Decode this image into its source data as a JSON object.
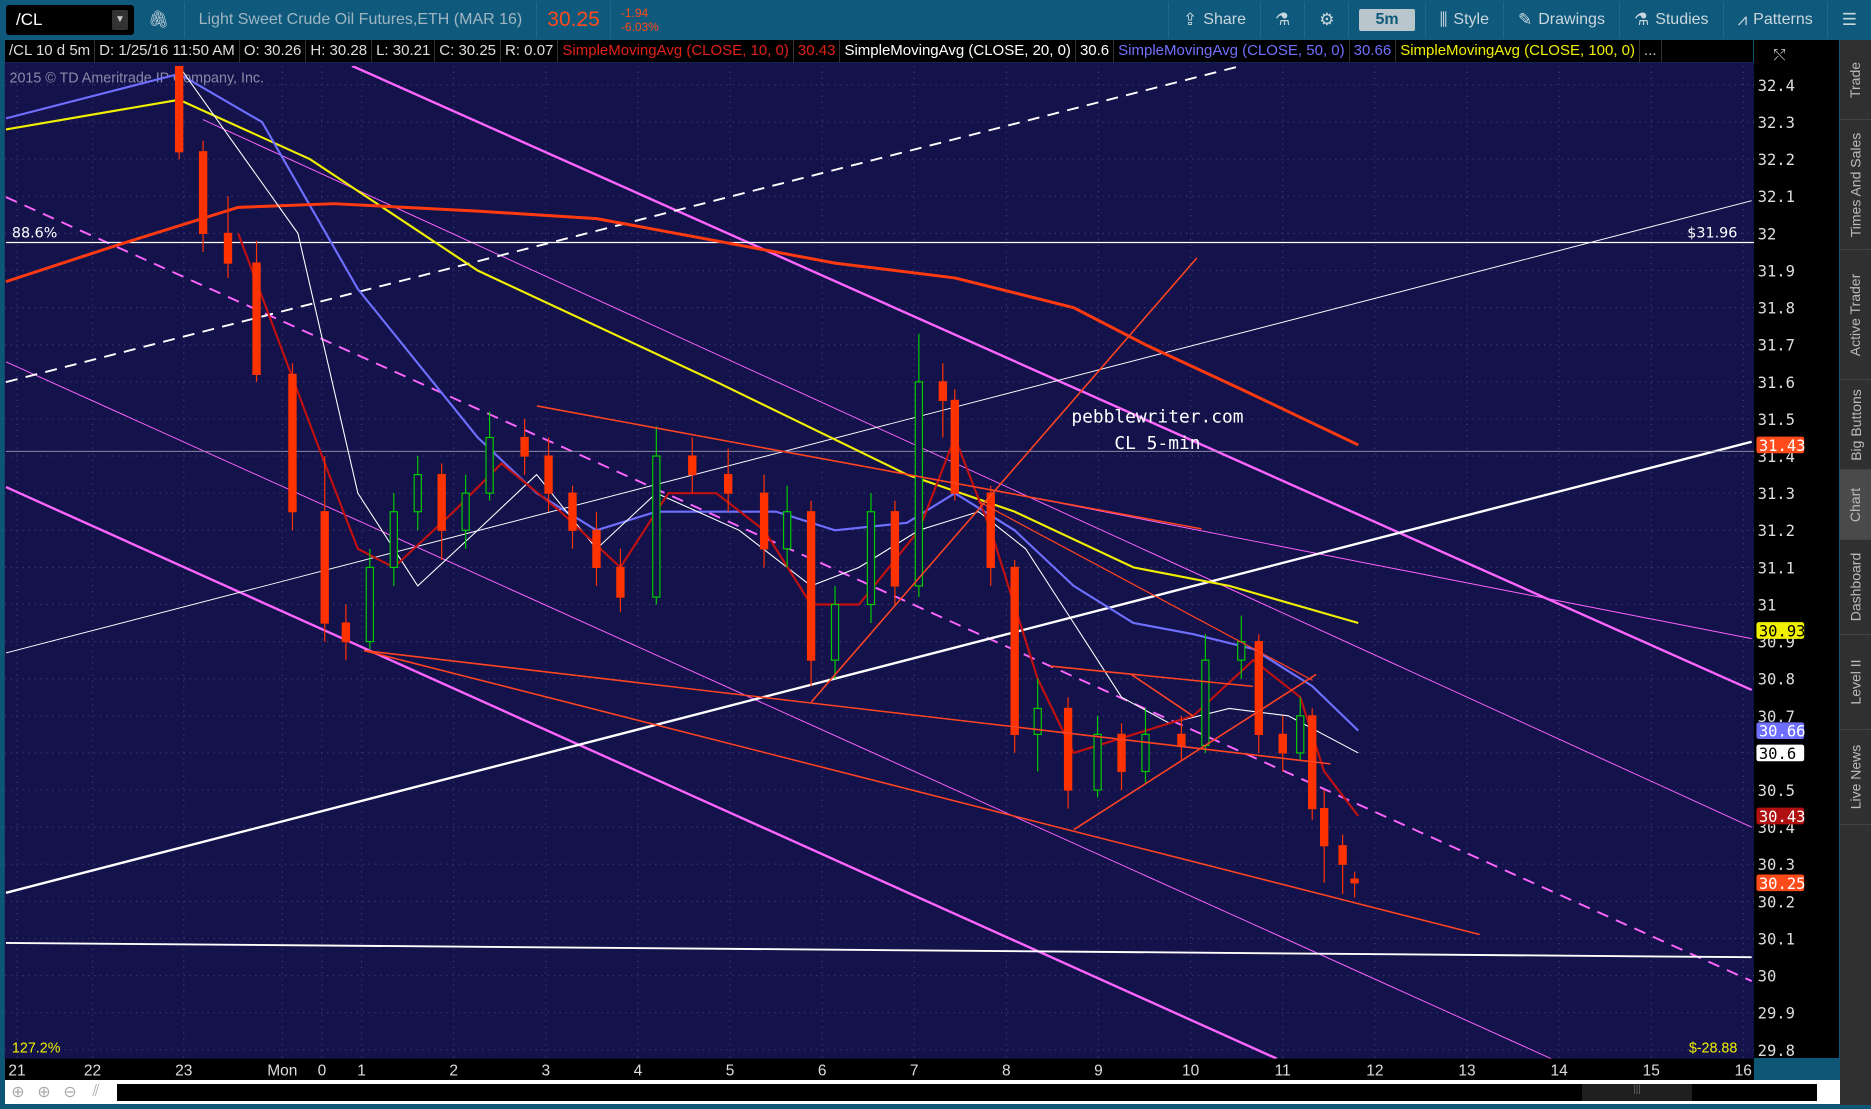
{
  "toolbar": {
    "symbol": "/CL",
    "description": "Light Sweet Crude Oil Futures,ETH (MAR 16)",
    "last": "30.25",
    "change": "-1.94",
    "change_pct": "-6.03%",
    "share": "Share",
    "timeframe": "5m",
    "style": "Style",
    "drawings": "Drawings",
    "studies": "Studies",
    "patterns": "Patterns"
  },
  "info": {
    "chart": "/CL 10 d 5m",
    "date": "D: 1/25/16 11:50 AM",
    "open": "O: 30.26",
    "high": "H: 30.28",
    "low": "L: 30.21",
    "close": "C: 30.25",
    "range": "R: 0.07",
    "studies": [
      {
        "name": "SimpleMovingAvg (CLOSE, 10, 0)",
        "value": "30.43",
        "color": "#e0201a"
      },
      {
        "name": "SimpleMovingAvg (CLOSE, 20, 0)",
        "value": "30.6",
        "color": "#ffffff"
      },
      {
        "name": "SimpleMovingAvg (CLOSE, 50, 0)",
        "value": "30.66",
        "color": "#7070ff"
      },
      {
        "name": "SimpleMovingAvg (CLOSE, 100, 0)",
        "value": "...",
        "color": "#f0f000"
      }
    ]
  },
  "watermark": "2015 © TD Ameritrade IP Company, Inc.",
  "annotation": {
    "line1": "pebblewriter.com",
    "line2": "CL 5-min"
  },
  "fib_labels": {
    "top_pct": "88.6%",
    "top_price": "$31.96",
    "bottom_pct": "127.2%",
    "bottom_price": "$-28.88"
  },
  "sidebar": [
    "Trade",
    "Times And Sales",
    "Active Trader",
    "Big Buttons",
    "Chart",
    "Dashboard",
    "Level II",
    "Live News"
  ],
  "colors": {
    "up": "#00cc00",
    "down": "#ff3300",
    "sma10": "#c01010",
    "sma20": "#ffffff",
    "sma50": "#6f6fff",
    "sma100": "#f0f000",
    "sma200": "#ff3a10",
    "background": "#14124a"
  },
  "chart_data": {
    "type": "candlestick",
    "ylim": [
      29.8,
      32.4
    ],
    "yticks": [
      "32.4",
      "32.3",
      "32.2",
      "32.1",
      "32",
      "31.9",
      "31.8",
      "31.7",
      "31.6",
      "31.5",
      "31.4",
      "31.3",
      "31.2",
      "31.1",
      "31",
      "30.9",
      "30.8",
      "30.7",
      "30.6",
      "30.5",
      "30.4",
      "30.3",
      "30.2",
      "30.1",
      "30",
      "29.9",
      "29.8"
    ],
    "xticks": [
      {
        "label": "21",
        "t": -2.74
      },
      {
        "label": "22",
        "t": -1.92
      },
      {
        "label": "23",
        "t": -0.93
      },
      {
        "label": "Mon",
        "t": 0.14
      },
      {
        "label": "0",
        "t": 0.57
      },
      {
        "label": "1",
        "t": 1
      },
      {
        "label": "2",
        "t": 2
      },
      {
        "label": "3",
        "t": 3
      },
      {
        "label": "4",
        "t": 4
      },
      {
        "label": "5",
        "t": 5
      },
      {
        "label": "6",
        "t": 6
      },
      {
        "label": "7",
        "t": 7
      },
      {
        "label": "8",
        "t": 8
      },
      {
        "label": "9",
        "t": 9
      },
      {
        "label": "10",
        "t": 10
      },
      {
        "label": "11",
        "t": 11
      },
      {
        "label": "12",
        "t": 12
      },
      {
        "label": "13",
        "t": 13
      },
      {
        "label": "14",
        "t": 14
      },
      {
        "label": "15",
        "t": 15
      },
      {
        "label": "16",
        "t": 16
      }
    ],
    "price_tags": [
      {
        "value": "31.43",
        "bg": "#ff4a1a",
        "fg": "#fff"
      },
      {
        "value": "30.93",
        "bg": "#f0f000",
        "fg": "#000"
      },
      {
        "value": "30.66",
        "bg": "#6f6fff",
        "fg": "#fff"
      },
      {
        "value": "30.6",
        "bg": "#ffffff",
        "fg": "#000"
      },
      {
        "value": "30.43",
        "bg": "#b01010",
        "fg": "#fff"
      },
      {
        "value": "30.25",
        "bg": "#ff4a1a",
        "fg": "#fff"
      }
    ],
    "candles": [
      [
        -0.98,
        32.45,
        32.47,
        32.2,
        32.22
      ],
      [
        -0.72,
        32.22,
        32.25,
        31.95,
        32.0
      ],
      [
        -0.45,
        32.0,
        32.1,
        31.88,
        31.92
      ],
      [
        -0.14,
        31.92,
        31.98,
        31.6,
        31.62
      ],
      [
        0.25,
        31.62,
        31.65,
        31.2,
        31.25
      ],
      [
        0.6,
        31.25,
        31.4,
        30.9,
        30.95
      ],
      [
        0.83,
        30.95,
        31.0,
        30.85,
        30.9
      ],
      [
        1.09,
        30.9,
        31.15,
        30.88,
        31.1
      ],
      [
        1.35,
        31.1,
        31.3,
        31.05,
        31.25
      ],
      [
        1.61,
        31.25,
        31.4,
        31.2,
        31.35
      ],
      [
        1.87,
        31.35,
        31.38,
        31.12,
        31.2
      ],
      [
        2.13,
        31.2,
        31.35,
        31.15,
        31.3
      ],
      [
        2.39,
        31.3,
        31.52,
        31.28,
        31.45
      ],
      [
        2.77,
        31.45,
        31.5,
        31.35,
        31.4
      ],
      [
        3.03,
        31.4,
        31.45,
        31.25,
        31.3
      ],
      [
        3.29,
        31.3,
        31.32,
        31.15,
        31.2
      ],
      [
        3.55,
        31.2,
        31.25,
        31.05,
        31.1
      ],
      [
        3.81,
        31.1,
        31.15,
        30.98,
        31.02
      ],
      [
        4.2,
        31.02,
        31.48,
        31.0,
        31.4
      ],
      [
        4.59,
        31.4,
        31.45,
        31.3,
        31.35
      ],
      [
        4.98,
        31.35,
        31.42,
        31.25,
        31.3
      ],
      [
        5.37,
        31.3,
        31.35,
        31.1,
        31.15
      ],
      [
        5.62,
        31.15,
        31.32,
        31.1,
        31.25
      ],
      [
        5.88,
        31.25,
        31.28,
        30.78,
        30.85
      ],
      [
        6.14,
        30.85,
        31.05,
        30.8,
        31.0
      ],
      [
        6.53,
        31.0,
        31.3,
        30.95,
        31.25
      ],
      [
        6.79,
        31.25,
        31.28,
        31.0,
        31.05
      ],
      [
        7.05,
        31.05,
        31.73,
        31.02,
        31.6
      ],
      [
        7.31,
        31.6,
        31.65,
        31.45,
        31.55
      ],
      [
        7.44,
        31.55,
        31.58,
        31.28,
        31.3
      ],
      [
        7.83,
        31.3,
        31.32,
        31.05,
        31.1
      ],
      [
        8.09,
        31.1,
        31.12,
        30.6,
        30.65
      ],
      [
        8.34,
        30.65,
        30.8,
        30.55,
        30.72
      ],
      [
        8.67,
        30.72,
        30.75,
        30.45,
        30.5
      ],
      [
        8.99,
        30.5,
        30.7,
        30.48,
        30.65
      ],
      [
        9.25,
        30.65,
        30.68,
        30.5,
        30.55
      ],
      [
        9.51,
        30.55,
        30.72,
        30.52,
        30.65
      ],
      [
        9.9,
        30.65,
        30.7,
        30.58,
        30.62
      ],
      [
        10.16,
        30.62,
        30.92,
        30.6,
        30.85
      ],
      [
        10.55,
        30.85,
        30.97,
        30.8,
        30.9
      ],
      [
        10.74,
        30.9,
        30.92,
        30.6,
        30.65
      ],
      [
        11.0,
        30.65,
        30.7,
        30.55,
        30.6
      ],
      [
        11.19,
        30.6,
        30.75,
        30.58,
        30.7
      ],
      [
        11.32,
        30.7,
        30.72,
        30.42,
        30.45
      ],
      [
        11.45,
        30.45,
        30.5,
        30.25,
        30.35
      ],
      [
        11.65,
        30.35,
        30.38,
        30.22,
        30.3
      ],
      [
        11.78,
        30.26,
        30.28,
        30.21,
        30.25
      ]
    ],
    "series": [
      {
        "name": "SMA100",
        "color": "#f0f000",
        "points": [
          [
            -2.86,
            32.28
          ],
          [
            -0.98,
            32.36
          ],
          [
            0.44,
            32.2
          ],
          [
            2.26,
            31.9
          ],
          [
            4.85,
            31.6
          ],
          [
            6.92,
            31.35
          ],
          [
            8.09,
            31.25
          ],
          [
            9.38,
            31.1
          ],
          [
            10.42,
            31.05
          ],
          [
            11.82,
            30.95
          ]
        ]
      },
      {
        "name": "SMA50",
        "color": "#6f6fff",
        "points": [
          [
            -2.86,
            32.31
          ],
          [
            -0.98,
            32.43
          ],
          [
            -0.08,
            32.3
          ],
          [
            0.96,
            31.85
          ],
          [
            2.26,
            31.45
          ],
          [
            2.9,
            31.3
          ],
          [
            3.55,
            31.2
          ],
          [
            4.2,
            31.25
          ],
          [
            4.85,
            31.25
          ],
          [
            5.5,
            31.25
          ],
          [
            6.14,
            31.2
          ],
          [
            6.92,
            31.22
          ],
          [
            7.44,
            31.3
          ],
          [
            8.09,
            31.2
          ],
          [
            8.73,
            31.05
          ],
          [
            9.38,
            30.95
          ],
          [
            10.03,
            30.92
          ],
          [
            10.68,
            30.88
          ],
          [
            11.32,
            30.78
          ],
          [
            11.82,
            30.66
          ]
        ]
      },
      {
        "name": "SMA200",
        "color": "#ff3a10",
        "points": [
          [
            -2.86,
            31.87
          ],
          [
            -1.63,
            31.97
          ],
          [
            -0.34,
            32.07
          ],
          [
            0.7,
            32.08
          ],
          [
            2.26,
            32.06
          ],
          [
            3.55,
            32.04
          ],
          [
            4.85,
            31.98
          ],
          [
            6.14,
            31.92
          ],
          [
            7.44,
            31.88
          ],
          [
            8.73,
            31.8
          ],
          [
            9.51,
            31.7
          ],
          [
            10.55,
            31.58
          ],
          [
            11.82,
            31.43
          ]
        ]
      },
      {
        "name": "SMA20",
        "color": "#ffffff",
        "points": [
          [
            -0.98,
            32.45
          ],
          [
            0.31,
            32.0
          ],
          [
            0.96,
            31.3
          ],
          [
            1.61,
            31.05
          ],
          [
            2.26,
            31.2
          ],
          [
            2.9,
            31.35
          ],
          [
            3.55,
            31.15
          ],
          [
            4.2,
            31.3
          ],
          [
            5.1,
            31.2
          ],
          [
            5.88,
            31.05
          ],
          [
            6.4,
            31.1
          ],
          [
            7.05,
            31.2
          ],
          [
            7.7,
            31.25
          ],
          [
            8.21,
            31.15
          ],
          [
            8.73,
            30.95
          ],
          [
            9.25,
            30.75
          ],
          [
            9.77,
            30.68
          ],
          [
            10.42,
            30.72
          ],
          [
            11.06,
            30.7
          ],
          [
            11.82,
            30.6
          ]
        ]
      },
      {
        "name": "SMA10",
        "color": "#c01010",
        "points": [
          [
            -0.34,
            32.0
          ],
          [
            0.57,
            31.4
          ],
          [
            0.96,
            31.15
          ],
          [
            1.35,
            31.1
          ],
          [
            2.0,
            31.25
          ],
          [
            2.52,
            31.38
          ],
          [
            3.16,
            31.25
          ],
          [
            3.81,
            31.1
          ],
          [
            4.33,
            31.3
          ],
          [
            4.85,
            31.3
          ],
          [
            5.37,
            31.2
          ],
          [
            5.88,
            31.0
          ],
          [
            6.4,
            31.0
          ],
          [
            7.05,
            31.2
          ],
          [
            7.44,
            31.45
          ],
          [
            7.83,
            31.2
          ],
          [
            8.34,
            30.8
          ],
          [
            8.73,
            30.6
          ],
          [
            9.38,
            30.65
          ],
          [
            10.03,
            30.7
          ],
          [
            10.68,
            30.85
          ],
          [
            11.19,
            30.75
          ],
          [
            11.45,
            30.55
          ],
          [
            11.82,
            30.43
          ]
        ]
      }
    ]
  }
}
